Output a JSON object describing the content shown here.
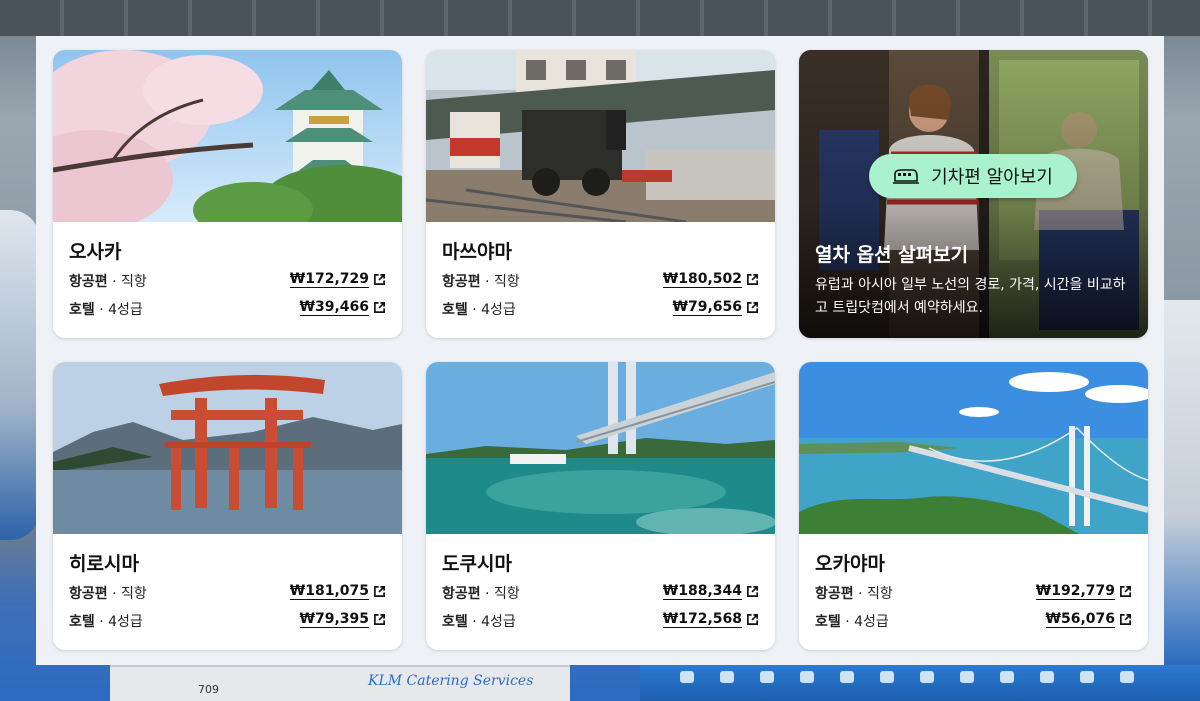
{
  "train_promo": {
    "button_label": "기차편 알아보기",
    "title": "열차 옵션 살펴보기",
    "description": "유럽과 아시아 일부 노선의 경로, 가격, 시간을 비교하고 트립닷컴에서 예약하세요."
  },
  "destinations": [
    {
      "city": "오사카",
      "flight_label": "항공편",
      "flight_type": "직항",
      "flight_price": "₩172,729",
      "hotel_label": "호텔",
      "hotel_type": "4성급",
      "hotel_price": "₩39,466"
    },
    {
      "city": "마쓰야마",
      "flight_label": "항공편",
      "flight_type": "직항",
      "flight_price": "₩180,502",
      "hotel_label": "호텔",
      "hotel_type": "4성급",
      "hotel_price": "₩79,656"
    },
    {
      "city": "히로시마",
      "flight_label": "항공편",
      "flight_type": "직항",
      "flight_price": "₩181,075",
      "hotel_label": "호텔",
      "hotel_type": "4성급",
      "hotel_price": "₩79,395"
    },
    {
      "city": "도쿠시마",
      "flight_label": "항공편",
      "flight_type": "직항",
      "flight_price": "₩188,344",
      "hotel_label": "호텔",
      "hotel_type": "4성급",
      "hotel_price": "₩172,568"
    },
    {
      "city": "오카야마",
      "flight_label": "항공편",
      "flight_type": "직항",
      "flight_price": "₩192,779",
      "hotel_label": "호텔",
      "hotel_type": "4성급",
      "hotel_price": "₩56,076"
    }
  ],
  "background": {
    "truck_number": "709",
    "truck_text": "KLM Catering Services"
  },
  "icons": {
    "external_link": "external-link-icon",
    "train": "train-icon"
  },
  "colors": {
    "panel_bg": "#eef1f6",
    "pill_bg": "#a9f2cd",
    "card_bg": "#ffffff"
  }
}
